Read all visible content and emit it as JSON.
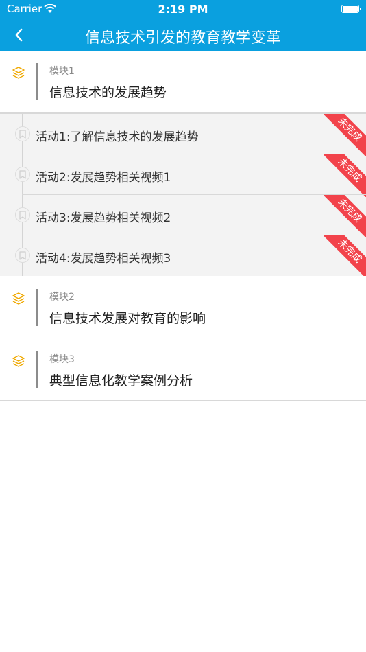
{
  "status_bar": {
    "carrier": "Carrier",
    "time": "2:19 PM"
  },
  "nav": {
    "title": "信息技术引发的教育教学变革",
    "back_icon": "chevron-left-icon"
  },
  "colors": {
    "primary": "#0aa0df",
    "badge": "#f2434b",
    "module_icon": "#f0a800"
  },
  "modules": [
    {
      "label": "模块1",
      "name": "信息技术的发展趋势"
    },
    {
      "label": "模块2",
      "name": "信息技术发展对教育的影响"
    },
    {
      "label": "模块3",
      "name": "典型信息化教学案例分析"
    }
  ],
  "activities": [
    {
      "title": "活动1:了解信息技术的发展趋势",
      "status": "未完成"
    },
    {
      "title": "活动2:发展趋势相关视频1",
      "status": "未完成"
    },
    {
      "title": "活动3:发展趋势相关视频2",
      "status": "未完成"
    },
    {
      "title": "活动4:发展趋势相关视频3",
      "status": "未完成"
    }
  ]
}
